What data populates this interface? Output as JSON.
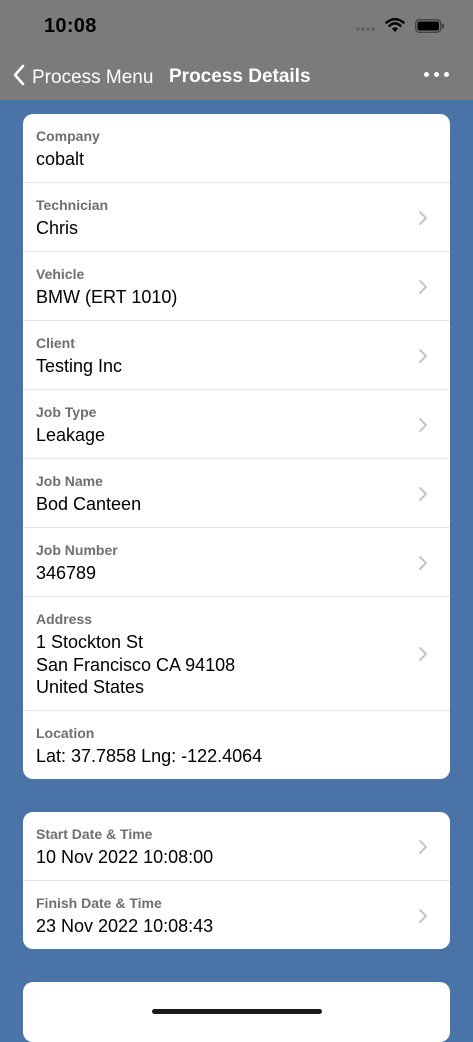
{
  "status_bar": {
    "time": "10:08"
  },
  "nav": {
    "back_label": "Process Menu",
    "title": "Process Details"
  },
  "details": [
    {
      "label": "Company",
      "value": "cobalt",
      "chevron": false
    },
    {
      "label": "Technician",
      "value": "Chris",
      "chevron": true
    },
    {
      "label": "Vehicle",
      "value": "BMW (ERT 1010)",
      "chevron": true
    },
    {
      "label": "Client",
      "value": "Testing Inc",
      "chevron": true
    },
    {
      "label": "Job Type",
      "value": "Leakage",
      "chevron": true
    },
    {
      "label": "Job Name",
      "value": "Bod Canteen",
      "chevron": true
    },
    {
      "label": "Job Number",
      "value": "346789",
      "chevron": true
    },
    {
      "label": "Address",
      "value_lines": [
        "1 Stockton St",
        "San Francisco CA 94108",
        "United States"
      ],
      "chevron": true
    },
    {
      "label": "Location",
      "value": "Lat: 37.7858 Lng: -122.4064",
      "chevron": false
    }
  ],
  "times": [
    {
      "label": "Start Date & Time",
      "value": "10 Nov 2022 10:08:00",
      "chevron": true
    },
    {
      "label": "Finish Date & Time",
      "value": "23 Nov 2022 10:08:43",
      "chevron": true
    }
  ],
  "colors": {
    "background": "#4a73a8",
    "nav_bar": "#7b7b7b",
    "card": "#ffffff"
  }
}
